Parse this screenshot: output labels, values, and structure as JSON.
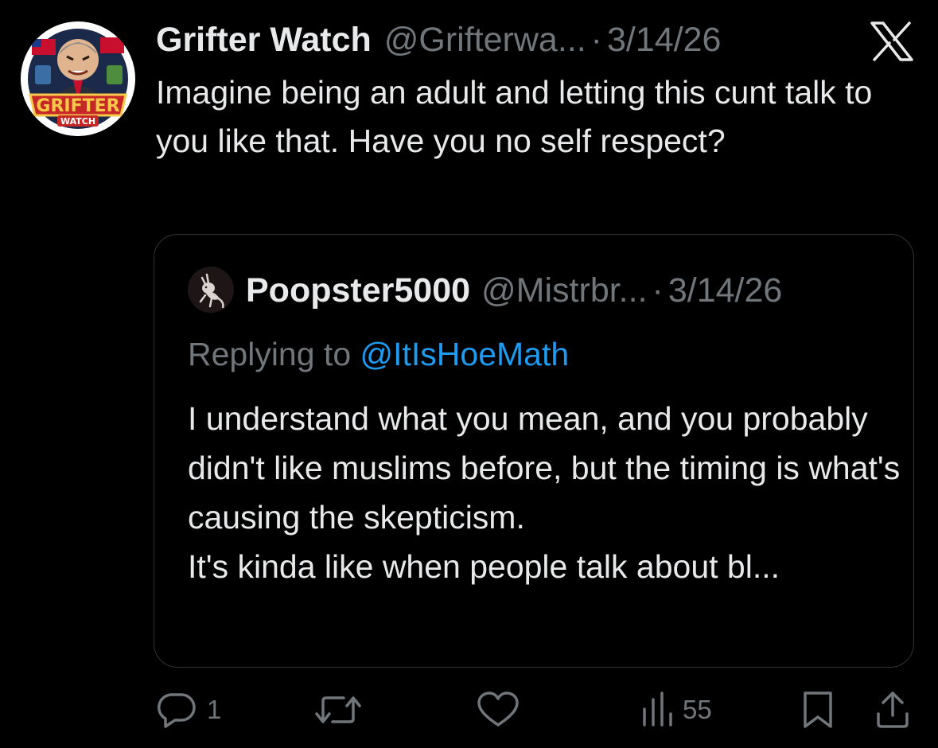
{
  "tweet": {
    "author_name": "Grifter Watch",
    "author_handle": "@Grifterwa...",
    "dot": "·",
    "date": "3/14/26",
    "avatar_badge_line1": "GRIFTER",
    "avatar_badge_line2": "WATCH",
    "text": "Imagine being an adult and letting this cunt talk to you like that. Have you no self respect?"
  },
  "quoted": {
    "author_name": "Poopster5000",
    "author_handle": "@Mistrbr...",
    "dot": "·",
    "date": "3/14/26",
    "replying_prefix": "Replying to ",
    "replying_mention": "@ItIsHoeMath",
    "text_lines": [
      "I understand what you mean, and you probably didn't like muslims before, but the timing is what's causing the skepticism.",
      "It's kinda like when people talk about bl..."
    ]
  },
  "actions": {
    "reply_count": "1",
    "views_count": "55"
  },
  "icons": {
    "platform_logo": "x-logo-icon",
    "reply": "reply-bubble-icon",
    "retweet": "retweet-icon",
    "like": "heart-icon",
    "views": "views-bar-chart-icon",
    "bookmark": "bookmark-icon",
    "share": "share-upload-icon"
  },
  "colors": {
    "background": "#000000",
    "primary_text": "#e7e9ea",
    "secondary_text": "#71767b",
    "link": "#1d9bf0",
    "border": "#2f3336"
  }
}
